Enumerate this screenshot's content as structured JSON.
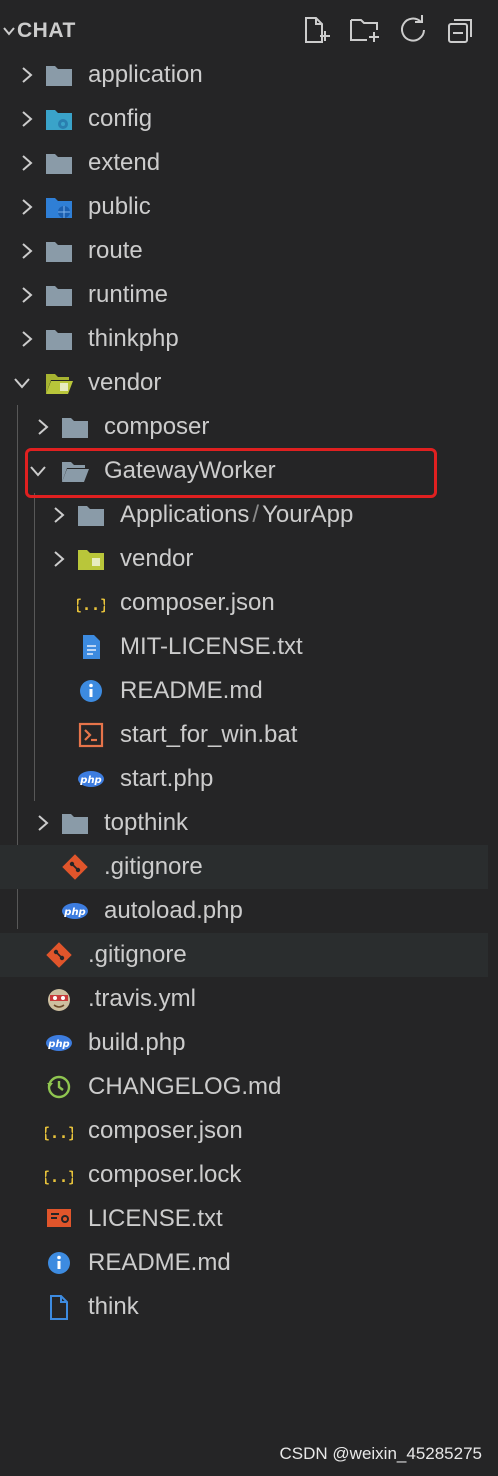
{
  "explorer": {
    "title": "CHAT",
    "actions": [
      "new-file",
      "new-folder",
      "refresh",
      "collapse-all"
    ]
  },
  "tree": {
    "application": "application",
    "config": "config",
    "extend": "extend",
    "public": "public",
    "route": "route",
    "runtime": "runtime",
    "thinkphp": "thinkphp",
    "vendor": "vendor",
    "composer": "composer",
    "gatewayworker": "GatewayWorker",
    "applications_a": "Applications",
    "applications_sep": "/",
    "applications_b": "YourApp",
    "gw_vendor": "vendor",
    "gw_composer_json": "composer.json",
    "gw_license": "MIT-LICENSE.txt",
    "gw_readme": "README.md",
    "gw_start_bat": "start_for_win.bat",
    "gw_start_php": "start.php",
    "topthink": "topthink",
    "vendor_gitignore": ".gitignore",
    "autoload": "autoload.php",
    "root_gitignore": ".gitignore",
    "travis": ".travis.yml",
    "build": "build.php",
    "changelog": "CHANGELOG.md",
    "composer_json": "composer.json",
    "composer_lock": "composer.lock",
    "license": "LICENSE.txt",
    "readme": "README.md",
    "think": "think"
  },
  "icon_labels": {
    "php": "php",
    "json": "{..}"
  },
  "colors": {
    "background": "#252526",
    "text": "#cccccc",
    "folder": "#8a9ba8",
    "highlight_border": "#e02020",
    "git": "#e0552b",
    "php": "#3d7de0",
    "json": "#e8c33b"
  },
  "watermark": "CSDN @weixin_45285275"
}
